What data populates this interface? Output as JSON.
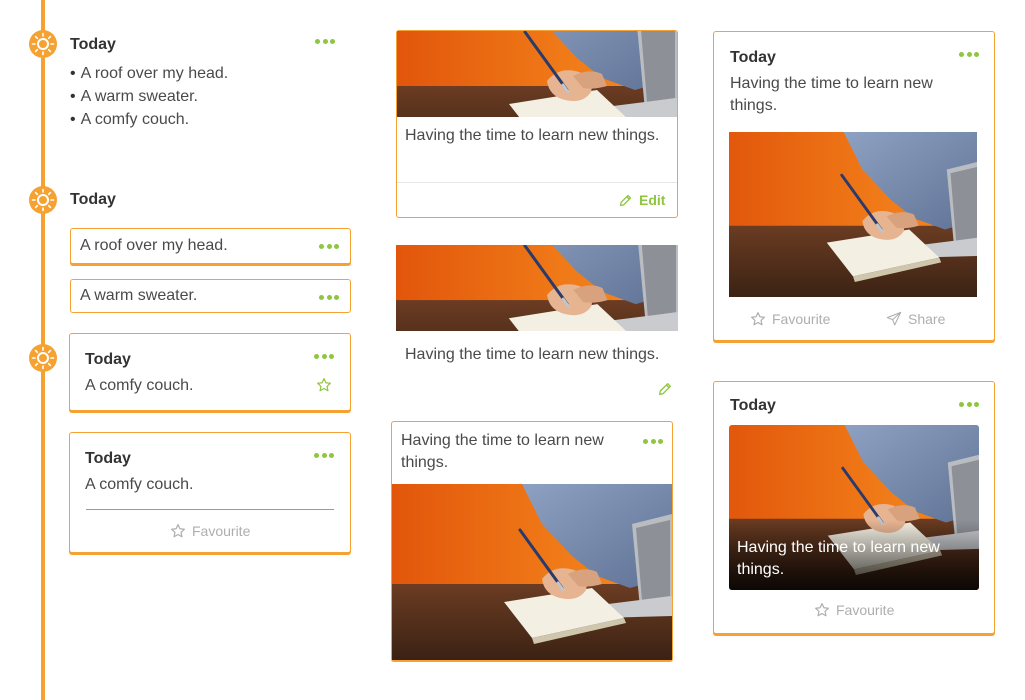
{
  "colors": {
    "accent": "#f5a233",
    "action": "#8ec63f",
    "muted": "#aeaeae"
  },
  "icons": {
    "timeline_node": "sun-icon",
    "more": "more-dots-icon",
    "star": "star-icon",
    "edit": "pencil-icon",
    "share": "send-icon"
  },
  "column1": {
    "entry1": {
      "heading": "Today",
      "items": [
        "A roof over my head.",
        "A warm sweater.",
        "A comfy couch."
      ]
    },
    "entry2": {
      "heading": "Today",
      "rows": [
        "A roof over my head.",
        "A warm sweater."
      ]
    },
    "card_a": {
      "heading": "Today",
      "text": "A comfy couch."
    },
    "card_b": {
      "heading": "Today",
      "text": "A comfy couch.",
      "favourite": "Favourite"
    }
  },
  "column2": {
    "card_edit": {
      "text": "Having the time to learn new things.",
      "edit_label": "Edit"
    },
    "plain": {
      "text": "Having the time to learn new things."
    },
    "card_text_top": {
      "text": "Having the time to learn new things."
    }
  },
  "column3": {
    "card_share": {
      "heading": "Today",
      "text": "Having the time to learn new things.",
      "favourite": "Favourite",
      "share": "Share"
    },
    "card_overlay": {
      "heading": "Today",
      "caption": "Having the time to learn new things.",
      "favourite": "Favourite"
    }
  }
}
